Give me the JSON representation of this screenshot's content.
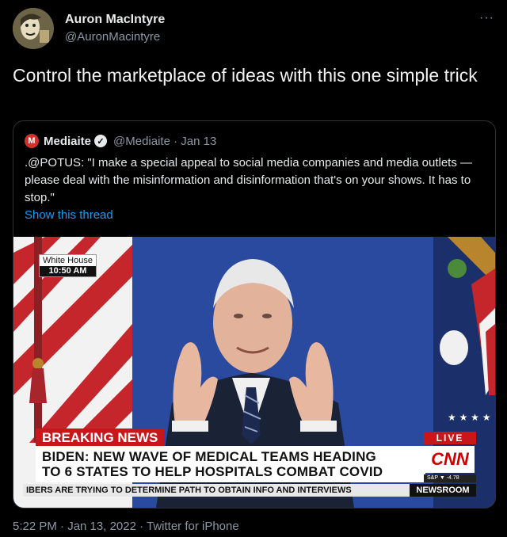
{
  "author": {
    "name": "Auron MacIntyre",
    "handle": "@AuronMacintyre",
    "more_icon": "ellipsis-icon"
  },
  "tweet": {
    "text": "Control the marketplace of ideas with this one simple trick",
    "footer": "5:22 PM · Jan 13, 2022 · Twitter for iPhone"
  },
  "quote": {
    "logo_letter": "M",
    "name": "Mediaite",
    "verified_icon": "verified-badge-icon",
    "handle_date": "@Mediaite · Jan 13",
    "text": ".@POTUS: \"I make a special appeal to social media companies and media outlets — please deal with the misinformation and disinformation that's on your shows. It has to stop.\"",
    "show_thread": "Show this thread"
  },
  "video": {
    "location": "White House",
    "time": "10:50 AM",
    "breaking": "BREAKING NEWS",
    "headline_1": "BIDEN: NEW WAVE OF MEDICAL TEAMS HEADING",
    "headline_2": "TO 6 STATES TO HELP HOSPITALS COMBAT COVID",
    "live": "LIVE",
    "network": "CNN",
    "market": "S&P  ▼ -4.78",
    "ticker": "IBERS ARE TRYING TO DETERMINE PATH TO OBTAIN INFO AND INTERVIEWS",
    "newsroom": "NEWSROOM"
  },
  "colors": {
    "background": "#000000",
    "link": "#1d9bf0",
    "muted": "#8b98a5",
    "cnn_red": "#c8171b"
  }
}
